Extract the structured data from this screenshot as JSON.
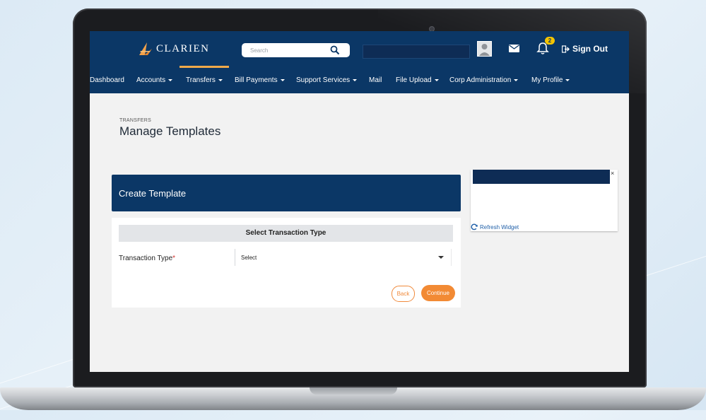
{
  "header": {
    "logo_text": "CLARIEN",
    "search_placeholder": "Search",
    "notification_count": "2",
    "sign_out_label": "Sign Out"
  },
  "nav": {
    "items": [
      {
        "label": "Dashboard",
        "dropdown": false
      },
      {
        "label": "Accounts",
        "dropdown": true
      },
      {
        "label": "Transfers",
        "dropdown": true
      },
      {
        "label": "Bill Payments",
        "dropdown": true
      },
      {
        "label": "Support Services",
        "dropdown": true
      },
      {
        "label": "Mail",
        "dropdown": false
      },
      {
        "label": "File Upload",
        "dropdown": true
      },
      {
        "label": "Corp Administration",
        "dropdown": true
      },
      {
        "label": "My Profile",
        "dropdown": true
      }
    ]
  },
  "page": {
    "breadcrumb": "TRANSFERS",
    "title": "Manage Templates"
  },
  "form": {
    "card_title": "Create Template",
    "section_title": "Select Transaction Type",
    "field_label": "Transaction Type",
    "required_mark": "*",
    "select_value": "Select",
    "back_label": "Back",
    "continue_label": "Continue"
  },
  "widget": {
    "close_glyph": "×",
    "refresh_label": "Refresh Widget"
  },
  "colors": {
    "brand_navy": "#0b3766",
    "accent_orange": "#f28a34",
    "badge_yellow": "#f4c400"
  }
}
